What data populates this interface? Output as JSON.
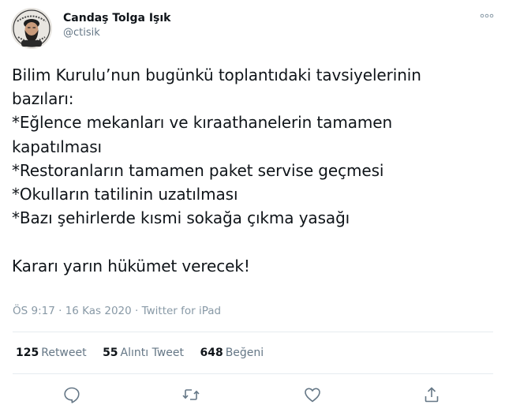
{
  "author": {
    "display_name": "Candaş Tolga Işık",
    "handle": "@ctisik",
    "avatar_icon": "profile-photo"
  },
  "more_icon": "ellipsis-icon",
  "tweet": {
    "lines": [
      "Bilim Kurulu’nun bugünkü toplantıdaki tavsiyelerinin",
      "bazıları:",
      "*Eğlence mekanları ve kıraathanelerin tamamen",
      "kapatılması",
      "*Restoranların tamamen paket servise geçmesi",
      "*Okulların tatilinin uzatılması",
      "*Bazı şehirlerde kısmi sokağa çıkma yasağı"
    ],
    "closing": "Kararı yarın hükümet verecek!"
  },
  "meta": {
    "time": "ÖS 9:17",
    "date": "16 Kas 2020",
    "source": "Twitter for iPad",
    "separator": " · "
  },
  "stats": {
    "retweets_count": "125",
    "retweets_label": "Retweet",
    "quotes_count": "55",
    "quotes_label": "Alıntı Tweet",
    "likes_count": "648",
    "likes_label": "Beğeni"
  },
  "actions": [
    "reply-icon",
    "retweet-icon",
    "like-icon",
    "share-icon"
  ],
  "colors": {
    "text": "#0f1419",
    "secondary": "#657786",
    "muted": "#8899a6",
    "divider": "#e6ecf0"
  }
}
